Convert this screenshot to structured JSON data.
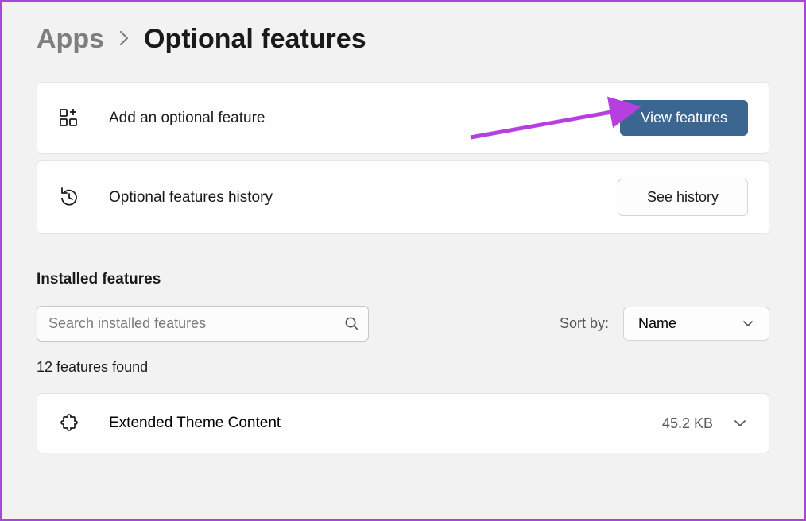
{
  "breadcrumb": {
    "parent": "Apps",
    "current": "Optional features"
  },
  "add_feature": {
    "label": "Add an optional feature",
    "button": "View features"
  },
  "history": {
    "label": "Optional features history",
    "button": "See history"
  },
  "installed": {
    "heading": "Installed features",
    "search_placeholder": "Search installed features",
    "sort_label": "Sort by:",
    "sort_value": "Name",
    "count_text": "12 features found"
  },
  "feature": {
    "name": "Extended Theme Content",
    "size": "45.2 KB"
  }
}
